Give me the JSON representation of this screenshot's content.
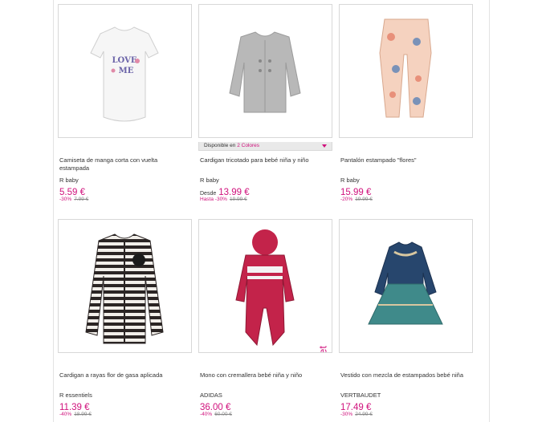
{
  "products": [
    {
      "name": "Camiseta de manga corta con vuelta estampada",
      "brand": "R baby",
      "desde": "",
      "price": "5.59 €",
      "discount": "-30%",
      "old_price": "7.99 €"
    },
    {
      "name": "Cardigan tricotado para bebé niña y niño",
      "brand": "R baby",
      "desde": "Desde",
      "price": "13.99 €",
      "discount": "Hasta -30%",
      "old_price": "19.99 €",
      "availability": {
        "label": "Disponible en",
        "colors": "2 Colores"
      }
    },
    {
      "name": "Pantalón estampado \"flores\"",
      "brand": "R baby",
      "desde": "",
      "price": "15.99 €",
      "discount": "-20%",
      "old_price": "19.99 €"
    },
    {
      "name": "Cardigan a rayas flor de gasa aplicada",
      "brand": "R essentiels",
      "desde": "",
      "price": "11.39 €",
      "discount": "-40%",
      "old_price": "18.99 €"
    },
    {
      "name": "Mono con cremallera bebé niña y niño",
      "brand": "ADIDAS",
      "desde": "",
      "price": "36.00 €",
      "discount": "-40%",
      "old_price": "60.00 €",
      "badge": "Outlet"
    },
    {
      "name": "Vestido con mezcla de estampados bebé niña",
      "brand": "VERTBAUDET",
      "desde": "",
      "price": "17.49 €",
      "discount": "-30%",
      "old_price": "24.99 €"
    }
  ],
  "colors": {
    "accent": "#d0117c"
  }
}
